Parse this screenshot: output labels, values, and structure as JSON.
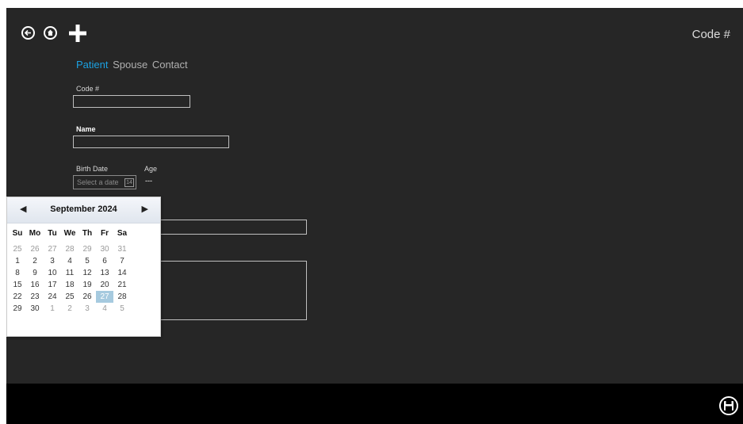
{
  "header": {
    "title": "Code #",
    "back_icon": "back-arrow-icon",
    "home_icon": "home-icon",
    "add_icon": "plus-icon"
  },
  "tabs": [
    {
      "label": "Patient",
      "active": true
    },
    {
      "label": "Spouse",
      "active": false
    },
    {
      "label": "Contact",
      "active": false
    }
  ],
  "form": {
    "code_label": "Code #",
    "code_value": "",
    "name_label": "Name",
    "name_value": "",
    "birth_date_label": "Birth Date",
    "birth_date_placeholder": "Select a date",
    "calendar_glyph_text": "14",
    "age_label": "Age",
    "age_value": "---"
  },
  "calendar": {
    "title": "September 2024",
    "prev_symbol": "◀",
    "next_symbol": "▶",
    "days_of_week": [
      "Su",
      "Mo",
      "Tu",
      "We",
      "Th",
      "Fr",
      "Sa"
    ],
    "weeks": [
      [
        "25",
        "26",
        "27",
        "28",
        "29",
        "30",
        "31"
      ],
      [
        "1",
        "2",
        "3",
        "4",
        "5",
        "6",
        "7"
      ],
      [
        "8",
        "9",
        "10",
        "11",
        "12",
        "13",
        "14"
      ],
      [
        "15",
        "16",
        "17",
        "18",
        "19",
        "20",
        "21"
      ],
      [
        "22",
        "23",
        "24",
        "25",
        "26",
        "27",
        "28"
      ],
      [
        "29",
        "30",
        "1",
        "2",
        "3",
        "4",
        "5"
      ]
    ],
    "selected_day": "27"
  },
  "footer": {
    "save_icon": "save-icon"
  },
  "colors": {
    "background": "#262626",
    "accent": "#1ba1e2",
    "bottom_bar": "#000000",
    "selected_day": "#a6cadf"
  }
}
